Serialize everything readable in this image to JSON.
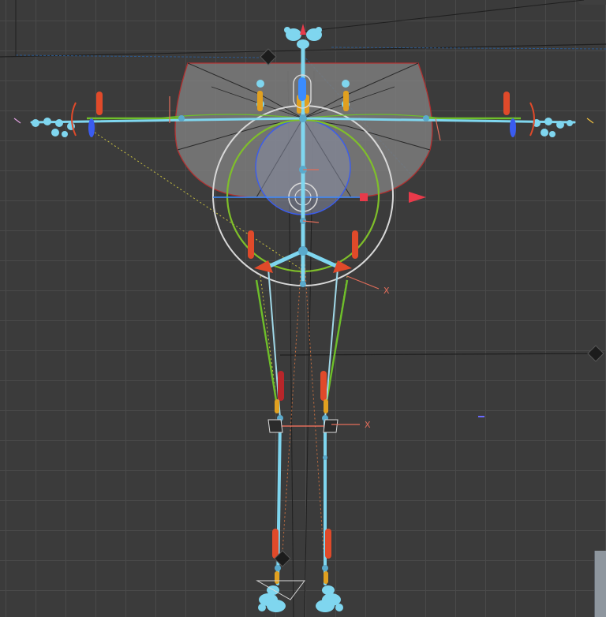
{
  "viewport": {
    "name": "3D rig viewport",
    "background": "#3b3b3b",
    "grid_color": "#4a4a4a"
  },
  "gizmo": {
    "axis_labels": {
      "hip_x": "X",
      "knee_x": "X"
    },
    "colors": {
      "bone": "#7fd6ef",
      "ik_chain": "#6ebf2a",
      "controller": "#e04a2a",
      "root_ring": "#d8d8d8",
      "cog_ring": "#7fbf2a",
      "x_axis": "#e83a4a",
      "y_axis": "#3a8cff",
      "shape": "#8a8a8a"
    },
    "icons": [
      "locator-diamond-icon",
      "translate-arrow-icon"
    ]
  }
}
